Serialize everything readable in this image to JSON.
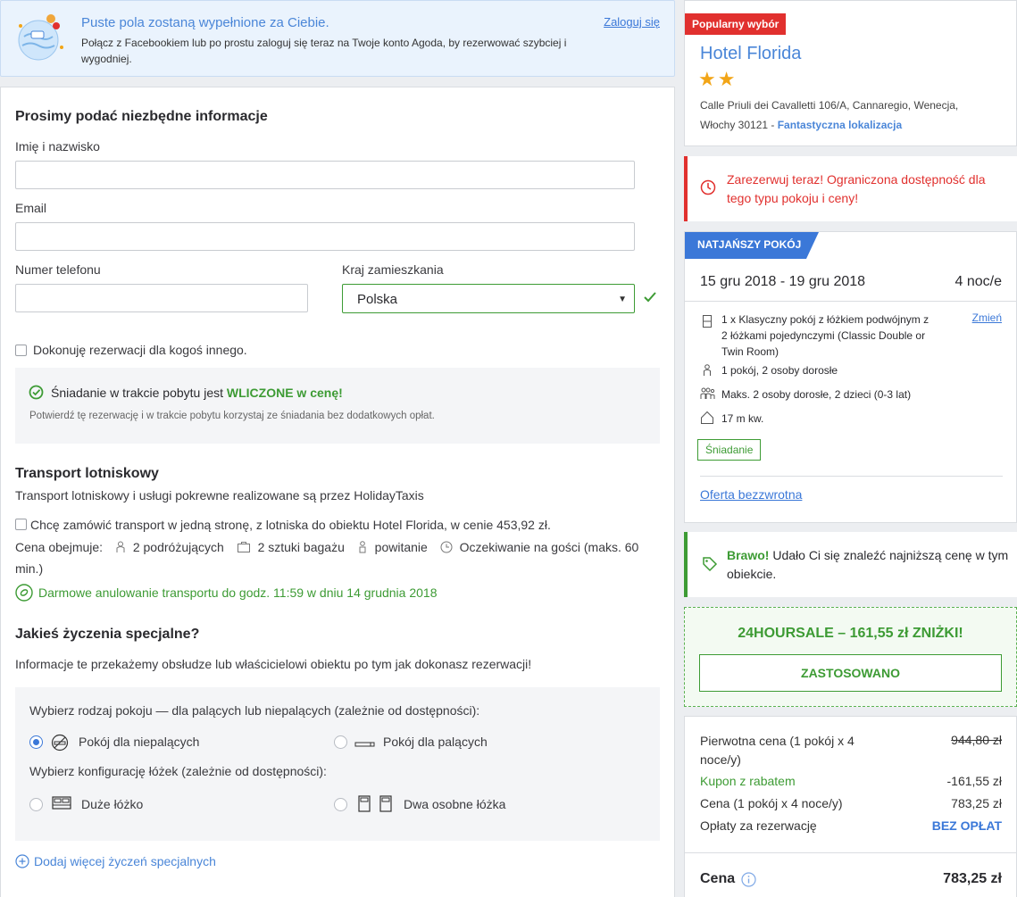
{
  "banner": {
    "title": "Puste pola zostaną wypełnione za Ciebie.",
    "desc": "Połącz z Facebookiem lub po prostu zaloguj się teraz na Twoje konto Agoda, by rezerwować szybciej i wygodniej.",
    "login": "Zaloguj się"
  },
  "form": {
    "heading": "Prosimy podać niezbędne informacje",
    "name_label": "Imię i nazwisko",
    "name_value": "",
    "email_label": "Email",
    "email_value": "",
    "phone_label": "Numer telefonu",
    "phone_value": "",
    "country_label": "Kraj zamieszkania",
    "country_value": "Polska",
    "book_for_other": "Dokonuję rezerwacji dla kogoś innego."
  },
  "breakfast": {
    "text_prefix": "Śniadanie w trakcie pobytu jest",
    "text_highlight": "WLICZONE w cenę!",
    "desc": "Potwierdź tę rezerwację i w trakcie pobytu korzystaj ze śniadania bez dodatkowych opłat."
  },
  "transport": {
    "heading": "Transport lotniskowy",
    "provider": "Transport lotniskowy i usługi pokrewne realizowane są przez HolidayTaxis",
    "option": "Chcę zamówić transport w jedną stronę, z lotniska do obiektu Hotel Florida, w cenie 453,92 zł.",
    "includes_label": "Cena obejmuje:",
    "travelers": "2 podróżujących",
    "luggage": "2 sztuki bagażu",
    "greeting": "powitanie",
    "waiting": "Oczekiwanie na gości (maks. 60 min.)",
    "cancellation": "Darmowe anulowanie transportu do godz. 11:59 w dniu 14 grudnia 2018"
  },
  "special": {
    "heading": "Jakieś życzenia specjalne?",
    "desc": "Informacje te przekażemy obsłudze lub właścicielowi obiektu po tym jak dokonasz rezerwacji!",
    "smoking_label": "Wybierz rodzaj pokoju — dla palących lub niepalących (zależnie od dostępności):",
    "non_smoking": "Pokój dla niepalących",
    "smoking": "Pokój dla palących",
    "bed_label": "Wybierz konfigurację łóżek (zależnie od dostępności):",
    "big_bed": "Duże łóżko",
    "twin_beds": "Dwa osobne łóżka",
    "add_more": "Dodaj więcej życzeń specjalnych"
  },
  "hotel": {
    "badge": "Popularny wybór",
    "name": "Hotel Florida",
    "stars": "★★",
    "address": "Calle Priuli dei Cavalletti 106/A, Cannaregio, Wenecja, Włochy 30121 -",
    "location_tag": "Fantastyczna lokalizacja"
  },
  "urgent": {
    "text": "Zarezerwuj teraz! Ograniczona dostępność dla tego typu pokoju i ceny!"
  },
  "room": {
    "tag": "NATJAŃSZY POKÓJ",
    "dates": "15 gru 2018 - 19 gru 2018",
    "nights": "4 noc/e",
    "room_desc": "1 x Klasyczny pokój z łóżkiem podwójnym z 2 łóżkami pojedynczymi (Classic Double or Twin Room)",
    "change": "Zmień",
    "occupancy": "1 pokój, 2 osoby dorosłe",
    "max_occ": "Maks. 2 osoby dorosłe, 2 dzieci (0-3 lat)",
    "size": "17 m kw.",
    "breakfast_pill": "Śniadanie",
    "nonrefund": "Oferta bezzwrotna"
  },
  "bravo": {
    "strong": "Brawo!",
    "text": "Udało Ci się znaleźć najniższą cenę w tym obiekcie."
  },
  "promo": {
    "title": "24HOURSALE – 161,55 zł ZNIŻKI!",
    "button": "ZASTOSOWANO"
  },
  "price": {
    "original_label": "Pierwotna cena (1 pokój x 4 noce/y)",
    "original_value": "944,80 zł",
    "coupon_label": "Kupon z rabatem",
    "coupon_value": "-161,55 zł",
    "price_label": "Cena (1 pokój x 4 noce/y)",
    "price_value": "783,25 zł",
    "fees_label": "Opłaty za rezerwację",
    "fees_value": "BEZ OPŁAT",
    "total_label": "Cena",
    "total_value": "783,25 zł"
  }
}
